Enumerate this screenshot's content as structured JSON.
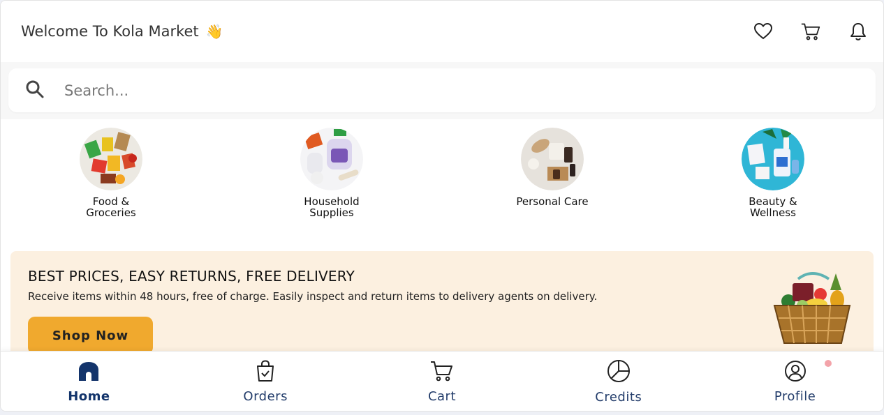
{
  "header": {
    "title": "Welcome To Kola Market",
    "emoji": "👋",
    "icons": [
      "heart-icon",
      "cart-icon",
      "bell-icon"
    ]
  },
  "search": {
    "placeholder": "Search..."
  },
  "categories": [
    {
      "label": "Food & Groceries",
      "image": "groceries-image"
    },
    {
      "label": "Household Supplies",
      "image": "household-image"
    },
    {
      "label": "Personal Care",
      "image": "personal-care-image"
    },
    {
      "label": "Beauty & Wellness",
      "image": "beauty-image"
    }
  ],
  "banner": {
    "heading": "BEST PRICES, EASY RETURNS, FREE DELIVERY",
    "text": "Receive items within 48 hours, free of charge. Easily inspect and return items to delivery agents on delivery.",
    "button": "Shop Now"
  },
  "nav": {
    "items": [
      {
        "label": "Home",
        "icon": "home-icon",
        "active": true
      },
      {
        "label": "Orders",
        "icon": "orders-icon"
      },
      {
        "label": "Cart",
        "icon": "cart-icon"
      },
      {
        "label": "Credits",
        "icon": "pie-chart-icon"
      },
      {
        "label": "Profile",
        "icon": "user-icon"
      }
    ]
  },
  "colors": {
    "accent": "#f0a92e",
    "nav_text": "#233d6b",
    "banner_bg": "#fcf0e0"
  }
}
